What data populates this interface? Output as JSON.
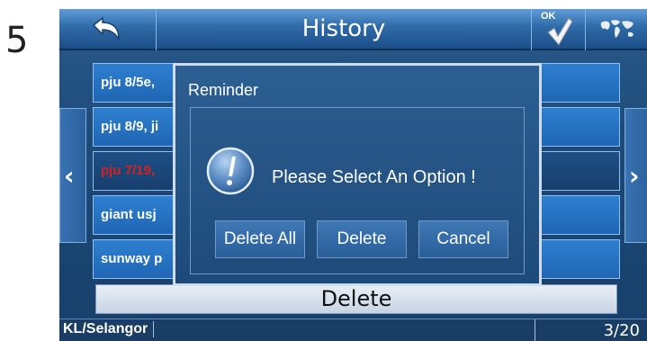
{
  "step_number": "5",
  "header": {
    "title": "History",
    "ok_label": "OK",
    "back_icon": "back-arrow-icon",
    "ok_icon": "checkmark-icon",
    "map_icon": "world-map-icon"
  },
  "history": {
    "items": [
      {
        "name": "pju 8/5e,",
        "selected": false
      },
      {
        "name": "pju 8/9, ji",
        "selected": false
      },
      {
        "name": "pju 7/19,",
        "selected": true
      },
      {
        "name": "giant usj",
        "selected": false
      },
      {
        "name": "sunway p",
        "selected": false
      }
    ],
    "prev_arrow": "‹",
    "next_arrow": "›"
  },
  "delete_bar": {
    "label": "Delete"
  },
  "status": {
    "region": "KL/Selangor",
    "page": "3/20"
  },
  "dialog": {
    "title": "Reminder",
    "message": "Please Select An Option !",
    "buttons": {
      "delete_all": "Delete All",
      "delete": "Delete",
      "cancel": "Cancel"
    }
  },
  "colors": {
    "selected_text": "#d72020",
    "accent": "#2f6aa8"
  }
}
